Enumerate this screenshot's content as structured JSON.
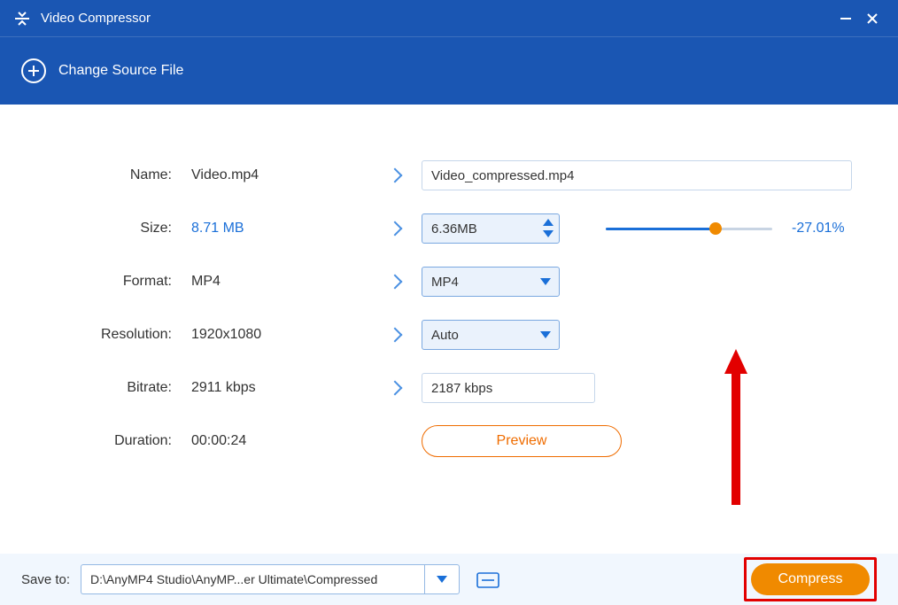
{
  "titlebar": {
    "title": "Video Compressor"
  },
  "subheader": {
    "change_source_label": "Change Source File"
  },
  "labels": {
    "name": "Name:",
    "size": "Size:",
    "format": "Format:",
    "resolution": "Resolution:",
    "bitrate": "Bitrate:",
    "duration": "Duration:"
  },
  "source": {
    "name": "Video.mp4",
    "size": "8.71 MB",
    "format": "MP4",
    "resolution": "1920x1080",
    "bitrate": "2911 kbps",
    "duration": "00:00:24"
  },
  "output": {
    "name": "Video_compressed.mp4",
    "size": "6.36MB",
    "format": "MP4",
    "resolution": "Auto",
    "bitrate": "2187 kbps",
    "size_reduction": "-27.01%"
  },
  "buttons": {
    "preview": "Preview",
    "compress": "Compress"
  },
  "footer": {
    "save_label": "Save to:",
    "path": "D:\\AnyMP4 Studio\\AnyMP...er Ultimate\\Compressed"
  }
}
